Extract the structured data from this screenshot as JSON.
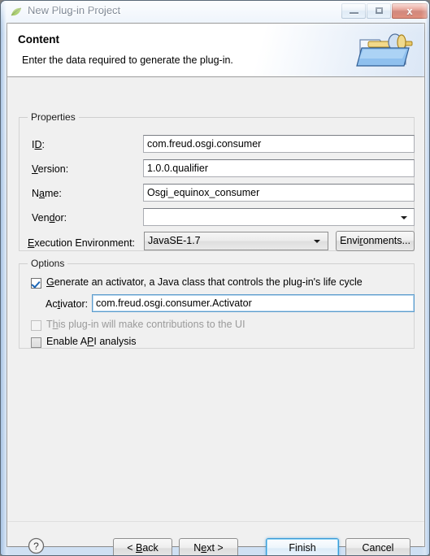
{
  "window": {
    "title": "New Plug-in Project",
    "icon": "eclipse-leaf-icon",
    "controls": {
      "minimize": "Minimize",
      "maximize": "Maximize",
      "close": "x"
    }
  },
  "banner": {
    "title": "Content",
    "description": "Enter the data required to generate the plug-in.",
    "image": "plugin-folder-banner-icon"
  },
  "properties": {
    "group_label": "Properties",
    "fields": [
      {
        "label_before": "I",
        "label_mnemonic": "D",
        "label_after": ":",
        "value": "com.freud.osgi.consumer"
      },
      {
        "label_before": "",
        "label_mnemonic": "V",
        "label_after": "ersion:",
        "value": "1.0.0.qualifier"
      },
      {
        "label_before": "N",
        "label_mnemonic": "a",
        "label_after": "me:",
        "value": "Osgi_equinox_consumer"
      },
      {
        "label_before": "Ven",
        "label_mnemonic": "d",
        "label_after": "or:",
        "value": ""
      }
    ],
    "execution_environment": {
      "label_before": "",
      "label_mnemonic": "E",
      "label_after": "xecution Environment:",
      "value": "JavaSE-1.7",
      "button_before": "Envi",
      "button_mnemonic": "r",
      "button_after": "onments..."
    }
  },
  "options": {
    "group_label": "Options",
    "generate_activator": {
      "label_before": "",
      "label_mnemonic": "G",
      "label_after": "enerate an activator, a Java class that controls the plug-in's life cycle",
      "checked": true
    },
    "activator": {
      "label_before": "Ac",
      "label_mnemonic": "t",
      "label_after": "ivator:",
      "value": "com.freud.osgi.consumer.Activator"
    },
    "ui_contributions": {
      "label_before": "T",
      "label_mnemonic": "h",
      "label_after": "is plug-in will make contributions to the UI",
      "checked": false,
      "enabled": false
    },
    "api_analysis": {
      "label_before": "Enable A",
      "label_mnemonic": "P",
      "label_after": "I analysis",
      "checked": false,
      "enabled": true
    }
  },
  "footer": {
    "help": "?",
    "back": {
      "before": "< ",
      "mnemonic": "B",
      "after": "ack"
    },
    "next": {
      "before": "N",
      "mnemonic": "e",
      "after": "xt >"
    },
    "finish": "Finish",
    "cancel": "Cancel"
  },
  "colors": {
    "accent": "#3c9ad6",
    "window_bg": "#f0f0f0",
    "close_red": "#cf4a34",
    "check_blue": "#1c66b5"
  }
}
